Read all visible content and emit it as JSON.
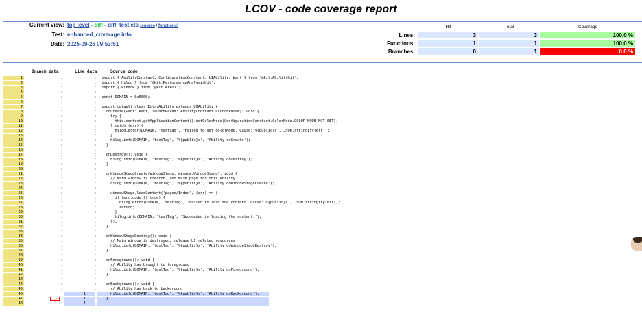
{
  "page": {
    "title": "LCOV - code coverage report"
  },
  "header": {
    "current_view_label": "Current view:",
    "crumb_top": "top level",
    "crumb_sep1": " - ",
    "crumb_diff": "diff",
    "crumb_sep2": " - ",
    "crumb_file": "diff_test.ets",
    "crumb_source": "(source",
    "crumb_slash": " / ",
    "crumb_functions": "functions)",
    "test_label": "Test:",
    "test_value": "enhanced_coverage.info",
    "date_label": "Date:",
    "date_value": "2025-09-26 09:53:51"
  },
  "summary": {
    "col_hit": "Hit",
    "col_total": "Total",
    "col_coverage": "Coverage",
    "rows": [
      {
        "label": "Lines:",
        "hit": "3",
        "total": "3",
        "coverage": "100.0 %",
        "status": "hi"
      },
      {
        "label": "Functions:",
        "hit": "1",
        "total": "1",
        "coverage": "100.0 %",
        "status": "hi"
      },
      {
        "label": "Branches:",
        "hit": "0",
        "total": "1",
        "coverage": "0.0 %",
        "status": "lo"
      }
    ]
  },
  "source_header": {
    "branch": "Branch data",
    "line": "Line data",
    "source": "Source code"
  },
  "colors": {
    "hit_bg": "#cad7fe",
    "line_no_bg": "#efe383",
    "branch_miss": "#ff0000"
  },
  "branch_marker": "[ – ]",
  "lines": [
    {
      "n": "1",
      "src": "  import { AbilityConstant, ConfigurationConstant, UIAbility, Want } from '@kit.AbilityKit';"
    },
    {
      "n": "2",
      "src": "  import { hilog } from '@kit.PerformanceAnalysisKit';"
    },
    {
      "n": "3",
      "src": "  import { window } from '@kit.ArkUI';"
    },
    {
      "n": "4",
      "src": ""
    },
    {
      "n": "5",
      "src": "  const DOMAIN = 0x0000;"
    },
    {
      "n": "6",
      "src": ""
    },
    {
      "n": "7",
      "src": "  export default class EntryAbility extends UIAbility {"
    },
    {
      "n": "8",
      "src": "    onCreate(want: Want, launchParam: AbilityConstant.LaunchParam): void {"
    },
    {
      "n": "9",
      "src": "      try {"
    },
    {
      "n": "10",
      "src": "        this.context.getApplicationContext().setColorMode(ConfigurationConstant.ColorMode.COLOR_MODE_NOT_SET);"
    },
    {
      "n": "11",
      "src": "      } catch (err) {"
    },
    {
      "n": "12",
      "src": "        hilog.error(DOMAIN, 'testTag', 'Failed to set colorMode. Cause: %{public}s', JSON.stringify(err));"
    },
    {
      "n": "13",
      "src": "      }"
    },
    {
      "n": "14",
      "src": "      hilog.info(DOMAIN, 'testTag', '%{public}s', 'Ability onCreate');"
    },
    {
      "n": "15",
      "src": "    }"
    },
    {
      "n": "16",
      "src": ""
    },
    {
      "n": "17",
      "src": "    onDestroy(): void {"
    },
    {
      "n": "18",
      "src": "      hilog.info(DOMAIN, 'testTag', '%{public}s', 'Ability onDestroy');"
    },
    {
      "n": "19",
      "src": "    }"
    },
    {
      "n": "20",
      "src": ""
    },
    {
      "n": "21",
      "src": "    onWindowStageCreate(windowStage: window.WindowStage): void {"
    },
    {
      "n": "22",
      "src": "      // Main window is created, set main page for this ability"
    },
    {
      "n": "23",
      "src": "      hilog.info(DOMAIN, 'testTag', '%{public}s', 'Ability onWindowStageCreate');"
    },
    {
      "n": "24",
      "src": ""
    },
    {
      "n": "25",
      "src": "      windowStage.loadContent('pages/Index', (err) => {"
    },
    {
      "n": "26",
      "src": "        if (err.code || true) {"
    },
    {
      "n": "27",
      "src": "          hilog.error(DOMAIN, 'testTag', 'Failed to load the content. Cause: %{public}s', JSON.stringify(err));"
    },
    {
      "n": "28",
      "src": "          return;"
    },
    {
      "n": "29",
      "src": "        }"
    },
    {
      "n": "30",
      "src": "        hilog.info(DOMAIN, 'testTag', 'Succeeded in loading the content.');"
    },
    {
      "n": "31",
      "src": "      });"
    },
    {
      "n": "32",
      "src": "    }"
    },
    {
      "n": "33",
      "src": ""
    },
    {
      "n": "34",
      "src": "    onWindowStageDestroy(): void {"
    },
    {
      "n": "35",
      "src": "      // Main window is destroyed, release UI related resources"
    },
    {
      "n": "36",
      "src": "      hilog.info(DOMAIN, 'testTag', '%{public}s', 'Ability onWindowStageDestroy');"
    },
    {
      "n": "37",
      "src": "    }"
    },
    {
      "n": "38",
      "src": ""
    },
    {
      "n": "39",
      "src": "    onForeground(): void {"
    },
    {
      "n": "40",
      "src": "      // Ability has brought to foreground"
    },
    {
      "n": "41",
      "src": "      hilog.info(DOMAIN, 'testTag', '%{public}s', 'Ability onForeground');"
    },
    {
      "n": "42",
      "src": "    }"
    },
    {
      "n": "43",
      "src": ""
    },
    {
      "n": "44",
      "src": "    onBackground(): void {"
    },
    {
      "n": "45",
      "src": "      // Ability has back to background"
    },
    {
      "n": "46",
      "src": "      hilog.info(DOMAIN, 'testTag', '%{public}s', 'Ability onBackground');",
      "hit": "1"
    },
    {
      "n": "47",
      "src": "    }",
      "hit": "1",
      "branch": true
    },
    {
      "n": "48",
      "src": "",
      "hit": "1"
    }
  ]
}
